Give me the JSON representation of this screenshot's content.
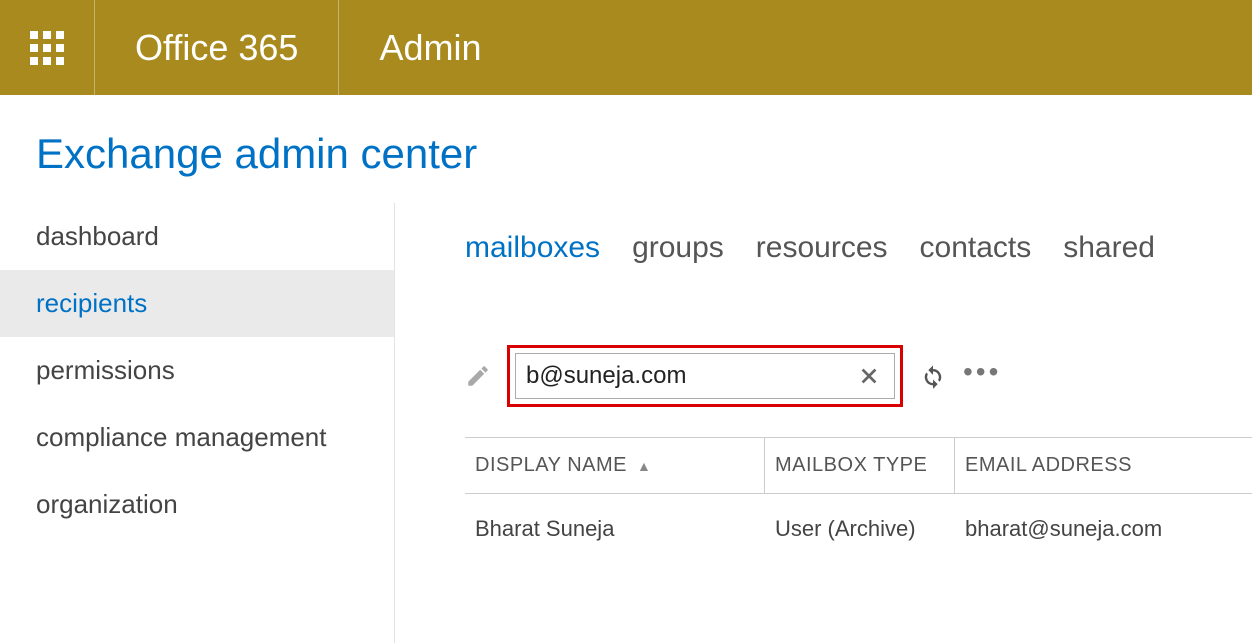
{
  "header": {
    "brand": "Office 365",
    "section": "Admin"
  },
  "page_title": "Exchange admin center",
  "sidebar": {
    "items": [
      {
        "label": "dashboard",
        "active": false
      },
      {
        "label": "recipients",
        "active": true
      },
      {
        "label": "permissions",
        "active": false
      },
      {
        "label": "compliance management",
        "active": false
      },
      {
        "label": "organization",
        "active": false
      }
    ]
  },
  "tabs": [
    {
      "label": "mailboxes",
      "active": true
    },
    {
      "label": "groups",
      "active": false
    },
    {
      "label": "resources",
      "active": false
    },
    {
      "label": "contacts",
      "active": false
    },
    {
      "label": "shared",
      "active": false
    }
  ],
  "search": {
    "value": "b@suneja.com"
  },
  "table": {
    "columns": [
      {
        "label": "DISPLAY NAME",
        "sorted": true
      },
      {
        "label": "MAILBOX TYPE",
        "sorted": false
      },
      {
        "label": "EMAIL ADDRESS",
        "sorted": false
      }
    ],
    "rows": [
      {
        "display_name": "Bharat Suneja",
        "mailbox_type": "User (Archive)",
        "email": "bharat@suneja.com"
      }
    ]
  }
}
